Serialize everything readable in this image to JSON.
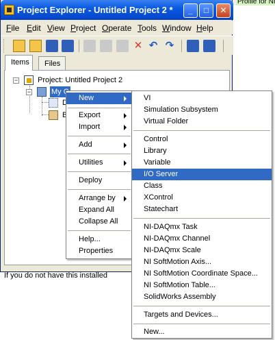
{
  "window": {
    "title": "Project Explorer - Untitled Project 2 *",
    "controls": {
      "minimize": "_",
      "maximize": "□",
      "close": "✕"
    }
  },
  "background": {
    "top_right_text": "Profile for NI",
    "body_text": "If you do not have this installed"
  },
  "menubar": [
    {
      "label": "File",
      "key": "F",
      "rest": "ile"
    },
    {
      "label": "Edit",
      "key": "E",
      "rest": "dit"
    },
    {
      "label": "View",
      "key": "V",
      "rest": "iew"
    },
    {
      "label": "Project",
      "key": "P",
      "rest": "roject"
    },
    {
      "label": "Operate",
      "key": "O",
      "rest": "perate"
    },
    {
      "label": "Tools",
      "key": "T",
      "rest": "ools"
    },
    {
      "label": "Window",
      "key": "W",
      "rest": "indow"
    },
    {
      "label": "Help",
      "key": "H",
      "rest": "elp"
    }
  ],
  "toolbar_icons": [
    "new-icon",
    "open-icon",
    "save-icon",
    "save-all-icon",
    "cut-icon",
    "copy-icon",
    "paste-icon",
    "delete-icon",
    "undo-icon",
    "redo-icon",
    "build-icon",
    "properties-icon"
  ],
  "tabs": {
    "items": "Items",
    "files": "Files"
  },
  "tree": {
    "project": "Project: Untitled Project 2",
    "computer": "My Computer",
    "computer_visible": "My C",
    "dependencies_visible": "D",
    "build_visible": "B"
  },
  "context_menu": {
    "items": [
      {
        "label": "New",
        "submenu": true,
        "highlighted": true
      },
      {
        "separator": true
      },
      {
        "label": "Export",
        "submenu": true
      },
      {
        "label": "Import",
        "submenu": true
      },
      {
        "separator": true
      },
      {
        "label": "Add",
        "submenu": true
      },
      {
        "separator": true
      },
      {
        "label": "Utilities",
        "submenu": true
      },
      {
        "separator": true
      },
      {
        "label": "Deploy"
      },
      {
        "separator": true
      },
      {
        "label": "Arrange by",
        "submenu": true
      },
      {
        "label": "Expand All"
      },
      {
        "label": "Collapse All"
      },
      {
        "separator": true
      },
      {
        "label": "Help..."
      },
      {
        "label": "Properties"
      }
    ]
  },
  "new_submenu": {
    "items": [
      {
        "label": "VI"
      },
      {
        "label": "Simulation Subsystem"
      },
      {
        "label": "Virtual Folder"
      },
      {
        "separator": true
      },
      {
        "label": "Control"
      },
      {
        "label": "Library"
      },
      {
        "label": "Variable"
      },
      {
        "label": "I/O Server",
        "highlighted": true
      },
      {
        "label": "Class"
      },
      {
        "label": "XControl"
      },
      {
        "label": "Statechart"
      },
      {
        "separator": true
      },
      {
        "label": "NI-DAQmx Task"
      },
      {
        "label": "NI-DAQmx Channel"
      },
      {
        "label": "NI-DAQmx Scale"
      },
      {
        "label": "NI SoftMotion Axis..."
      },
      {
        "label": "NI SoftMotion Coordinate Space..."
      },
      {
        "label": "NI SoftMotion Table..."
      },
      {
        "label": "SolidWorks Assembly"
      },
      {
        "separator": true
      },
      {
        "label": "Targets and Devices..."
      },
      {
        "separator": true
      },
      {
        "label": "New..."
      }
    ]
  },
  "colors": {
    "title_bar": "#0548cf",
    "highlight": "#316ac5",
    "window_bg": "#ece9d8"
  }
}
